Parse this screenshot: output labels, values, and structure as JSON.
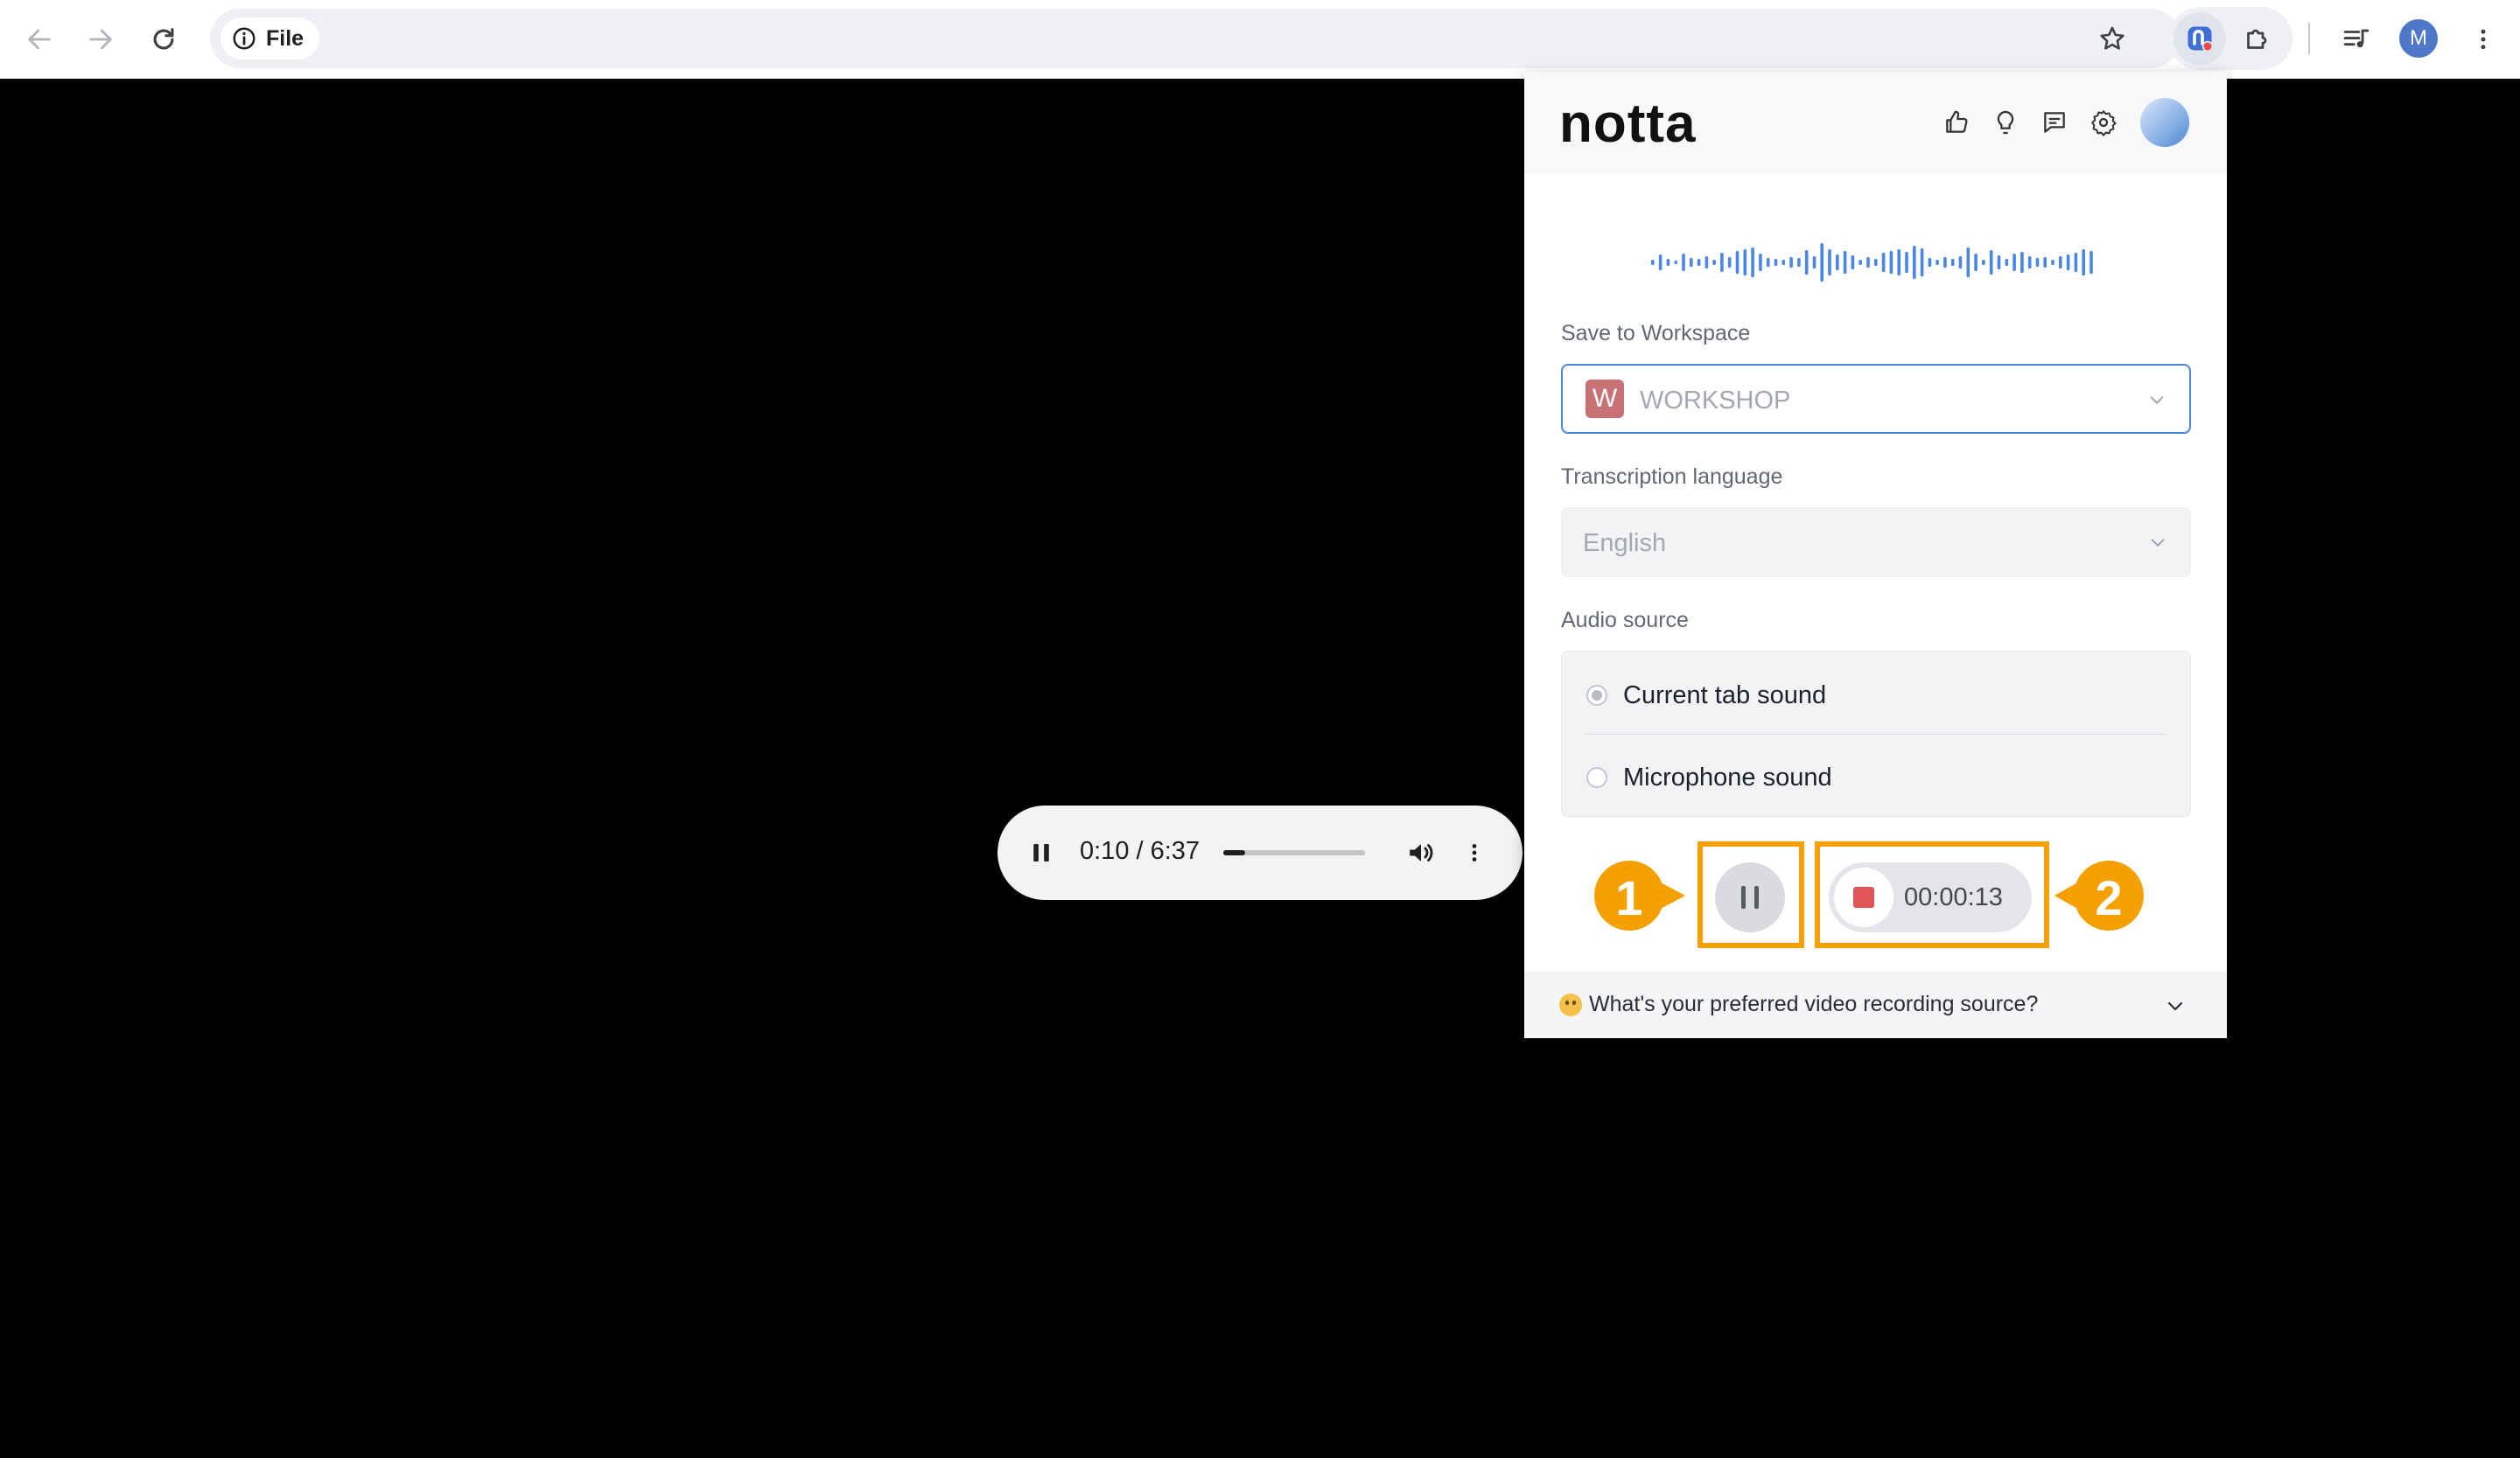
{
  "browser": {
    "site_chip": "File",
    "profile_initial": "M"
  },
  "player": {
    "time": "0:10 / 6:37",
    "progress_fraction": 0.026
  },
  "popup": {
    "logo": "notta",
    "workspace": {
      "label": "Save to Workspace",
      "badge": "W",
      "value": "WORKSHOP"
    },
    "language": {
      "label": "Transcription language",
      "value": "English"
    },
    "audio_source": {
      "label": "Audio source",
      "options": [
        {
          "label": "Current tab sound",
          "selected": true
        },
        {
          "label": "Microphone sound",
          "selected": false
        }
      ]
    },
    "recording_time": "00:00:13",
    "callouts": [
      "1",
      "2"
    ],
    "footer_question": "What's your preferred video recording source?"
  },
  "colors": {
    "accent_blue": "#4a86e8",
    "highlight_orange": "#f5a001",
    "record_red": "#e05656",
    "workspace_badge": "#c97276"
  }
}
